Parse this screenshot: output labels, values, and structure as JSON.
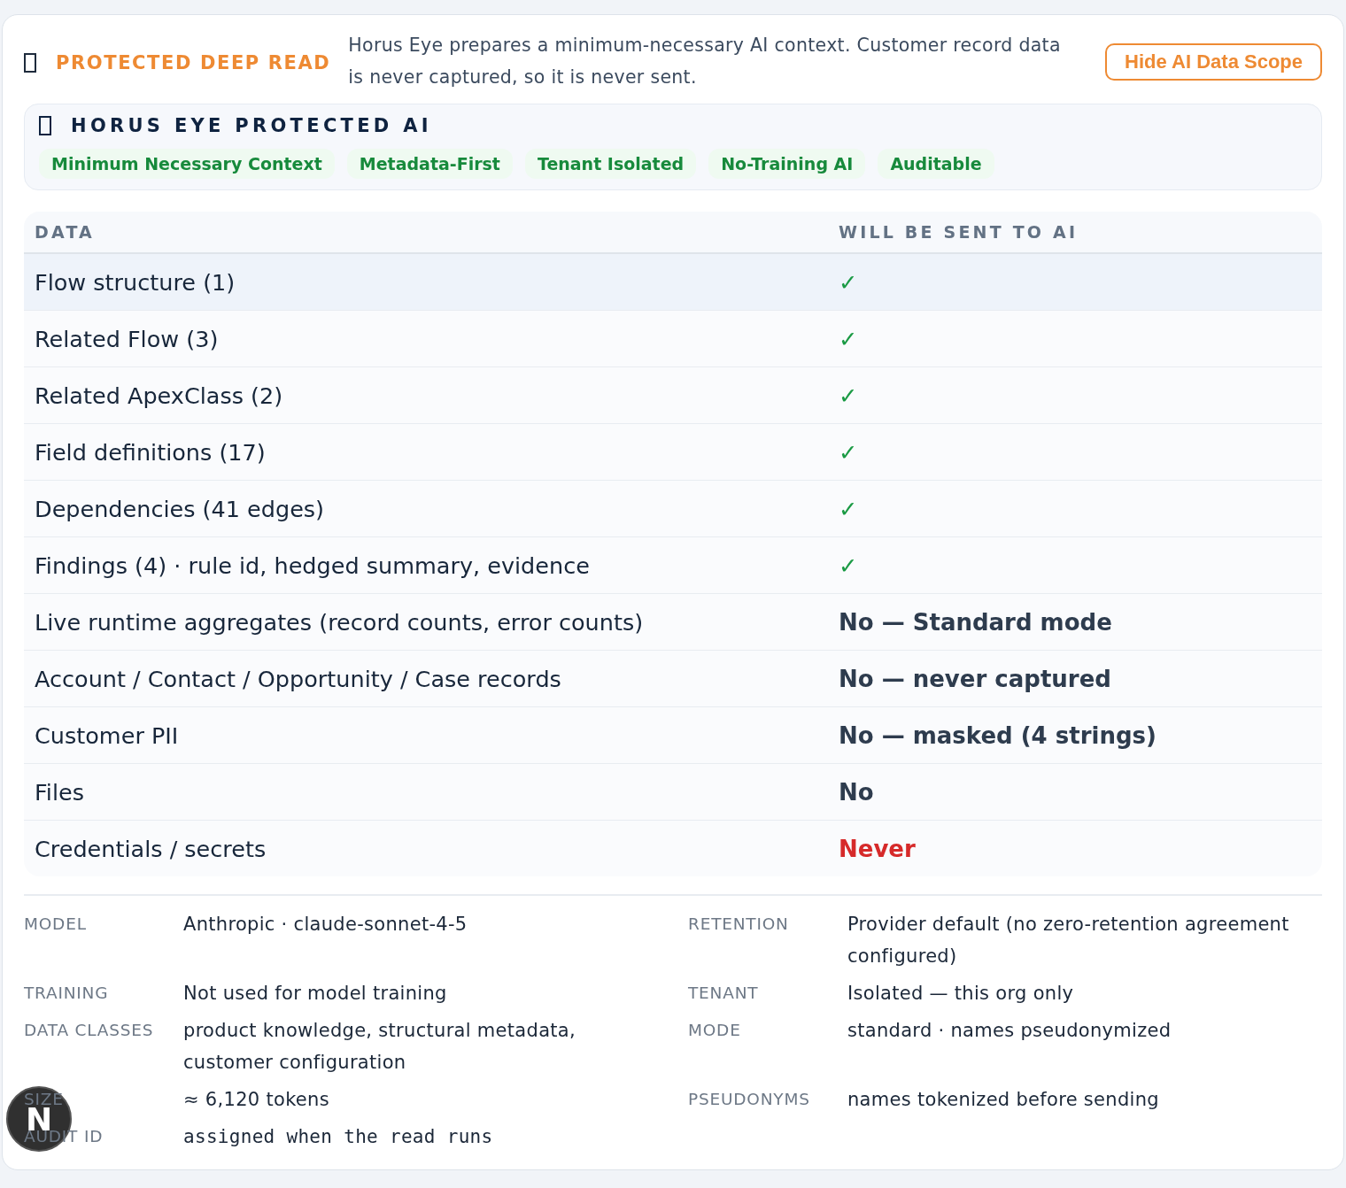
{
  "header": {
    "title": "PROTECTED DEEP READ",
    "description": "Horus Eye prepares a minimum-necessary AI context. Customer record data is never captured, so it is never sent.",
    "button": "Hide AI Data Scope"
  },
  "protected_panel": {
    "title": "HORUS EYE PROTECTED AI",
    "tags": [
      "Minimum Necessary Context",
      "Metadata-First",
      "Tenant Isolated",
      "No-Training AI",
      "Auditable"
    ]
  },
  "table": {
    "columns": [
      "DATA",
      "WILL BE SENT TO AI"
    ],
    "rows": [
      {
        "data": "Flow structure (1)",
        "sent": "✓",
        "kind": "check",
        "selected": true
      },
      {
        "data": "Related Flow (3)",
        "sent": "✓",
        "kind": "check",
        "selected": false
      },
      {
        "data": "Related ApexClass (2)",
        "sent": "✓",
        "kind": "check",
        "selected": false
      },
      {
        "data": "Field definitions (17)",
        "sent": "✓",
        "kind": "check",
        "selected": false
      },
      {
        "data": "Dependencies (41 edges)",
        "sent": "✓",
        "kind": "check",
        "selected": false
      },
      {
        "data": "Findings (4) · rule id, hedged summary, evidence",
        "sent": "✓",
        "kind": "check",
        "selected": false
      },
      {
        "data": "Live runtime aggregates (record counts, error counts)",
        "sent": "No — Standard mode",
        "kind": "no",
        "selected": false
      },
      {
        "data": "Account / Contact / Opportunity / Case records",
        "sent": "No — never captured",
        "kind": "no",
        "selected": false
      },
      {
        "data": "Customer PII",
        "sent": "No — masked (4 strings)",
        "kind": "no",
        "selected": false
      },
      {
        "data": "Files",
        "sent": "No",
        "kind": "no",
        "selected": false
      },
      {
        "data": "Credentials / secrets",
        "sent": "Never",
        "kind": "never",
        "selected": false
      }
    ]
  },
  "details": {
    "left": [
      {
        "label": "MODEL",
        "value": "Anthropic · claude-sonnet-4-5",
        "kind": "text"
      },
      {
        "label": "TRAINING",
        "value": "Not used for model training",
        "kind": "text"
      },
      {
        "label": "DATA CLASSES",
        "value": "product knowledge, structural metadata, customer configuration",
        "kind": "text"
      },
      {
        "label": "SIZE",
        "value": "≈ 6,120 tokens",
        "kind": "text"
      },
      {
        "label": "AUDIT ID",
        "value": "assigned when the read runs",
        "kind": "mono"
      }
    ],
    "right": [
      {
        "label": "RETENTION",
        "value": "Provider default (no zero-retention agreement configured)",
        "kind": "text"
      },
      {
        "label": "TENANT",
        "value": "Isolated — this org only",
        "kind": "text"
      },
      {
        "label": "MODE",
        "value": "standard · names pseudonymized",
        "kind": "text"
      },
      {
        "label": "PSEUDONYMS",
        "value": "names tokenized before sending",
        "kind": "text"
      }
    ]
  },
  "dev_badge": {
    "letter": "N"
  }
}
